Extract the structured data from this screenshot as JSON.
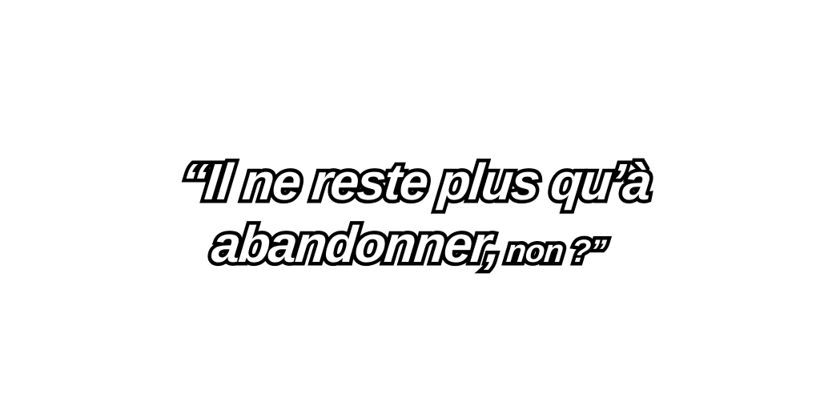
{
  "caption": {
    "line1": "“Il ne reste plus qu’à",
    "line2_main": "abandonner,",
    "line2_tail": " non ?”"
  },
  "colors": {
    "background": "#ffffff",
    "text_fill": "#ffffff",
    "text_outline": "#000000"
  }
}
